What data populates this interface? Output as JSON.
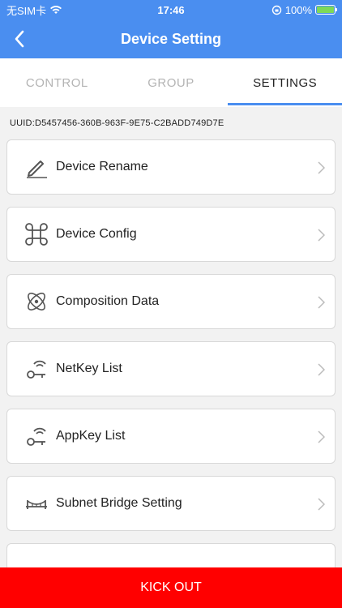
{
  "status_bar": {
    "carrier": "无SIM卡",
    "time": "17:46",
    "battery": "100%",
    "battery_level": 1.0
  },
  "nav": {
    "title": "Device Setting",
    "back_icon": "chevron-left-icon"
  },
  "tabs": [
    {
      "label": "CONTROL",
      "active": false
    },
    {
      "label": "GROUP",
      "active": false
    },
    {
      "label": "SETTINGS",
      "active": true
    }
  ],
  "uuid": "UUID:D5457456-360B-963F-9E75-C2BADD749D7E",
  "menu": [
    {
      "label": "Device Rename",
      "icon": "pencil-icon"
    },
    {
      "label": "Device Config",
      "icon": "command-icon"
    },
    {
      "label": "Composition Data",
      "icon": "atom-icon"
    },
    {
      "label": "NetKey List",
      "icon": "wifi-key-icon"
    },
    {
      "label": "AppKey List",
      "icon": "wifi-key-icon"
    },
    {
      "label": "Subnet Bridge Setting",
      "icon": "bridge-icon"
    },
    {
      "label": "",
      "icon": "partial-icon"
    }
  ],
  "kick_out": {
    "label": "KICK OUT",
    "color": "#ff0000"
  },
  "colors": {
    "primary": "#4a8ef0",
    "danger": "#ff0000"
  }
}
